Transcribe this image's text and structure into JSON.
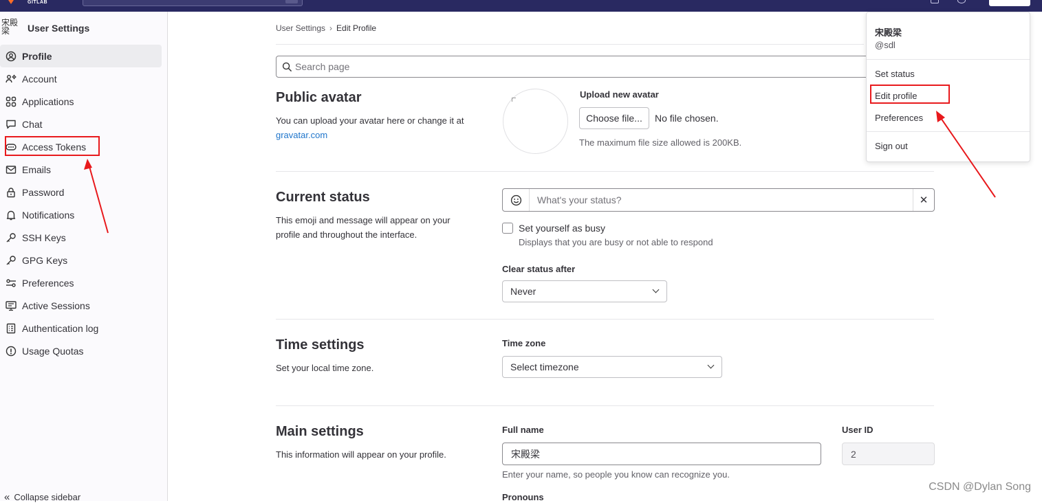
{
  "topbar": {
    "brand": "GITLAB"
  },
  "sidebar": {
    "avatar_alt": "宋殿梁",
    "title": "User Settings",
    "items": [
      {
        "label": "Profile",
        "icon": "profile-icon",
        "active": true
      },
      {
        "label": "Account",
        "icon": "account-icon"
      },
      {
        "label": "Applications",
        "icon": "applications-icon"
      },
      {
        "label": "Chat",
        "icon": "chat-icon"
      },
      {
        "label": "Access Tokens",
        "icon": "token-icon"
      },
      {
        "label": "Emails",
        "icon": "mail-icon"
      },
      {
        "label": "Password",
        "icon": "lock-icon"
      },
      {
        "label": "Notifications",
        "icon": "bell-icon"
      },
      {
        "label": "SSH Keys",
        "icon": "key-icon"
      },
      {
        "label": "GPG Keys",
        "icon": "key-icon"
      },
      {
        "label": "Preferences",
        "icon": "preferences-icon"
      },
      {
        "label": "Active Sessions",
        "icon": "monitor-icon"
      },
      {
        "label": "Authentication log",
        "icon": "log-icon"
      },
      {
        "label": "Usage Quotas",
        "icon": "quota-icon"
      }
    ],
    "collapse_label": "Collapse sidebar"
  },
  "breadcrumb": {
    "parent": "User Settings",
    "current": "Edit Profile"
  },
  "search": {
    "placeholder": "Search page"
  },
  "avatar_section": {
    "title": "Public avatar",
    "desc": "You can upload your avatar here or change it at",
    "link": "gravatar.com",
    "upload_label": "Upload new avatar",
    "choose_button": "Choose file...",
    "no_file": "No file chosen.",
    "max_size": "The maximum file size allowed is 200KB."
  },
  "status_section": {
    "title": "Current status",
    "desc": "This emoji and message will appear on your profile and throughout the interface.",
    "placeholder": "What's your status?",
    "busy_label": "Set yourself as busy",
    "busy_help": "Displays that you are busy or not able to respond",
    "clear_label": "Clear status after",
    "clear_value": "Never"
  },
  "time_section": {
    "title": "Time settings",
    "desc": "Set your local time zone.",
    "tz_label": "Time zone",
    "tz_value": "Select timezone"
  },
  "main_section": {
    "title": "Main settings",
    "desc": "This information will appear on your profile.",
    "fullname_label": "Full name",
    "fullname_value": "宋殿梁",
    "fullname_help": "Enter your name, so people you know can recognize you.",
    "userid_label": "User ID",
    "userid_value": "2",
    "pronouns_label": "Pronouns"
  },
  "user_menu": {
    "name": "宋殿梁",
    "username": "@sdl",
    "set_status": "Set status",
    "edit_profile": "Edit profile",
    "preferences": "Preferences",
    "sign_out": "Sign out"
  },
  "watermark": "CSDN @Dylan  Song",
  "colors": {
    "annotation": "#e8191c",
    "topbar": "#292961",
    "link": "#1f75cb"
  }
}
